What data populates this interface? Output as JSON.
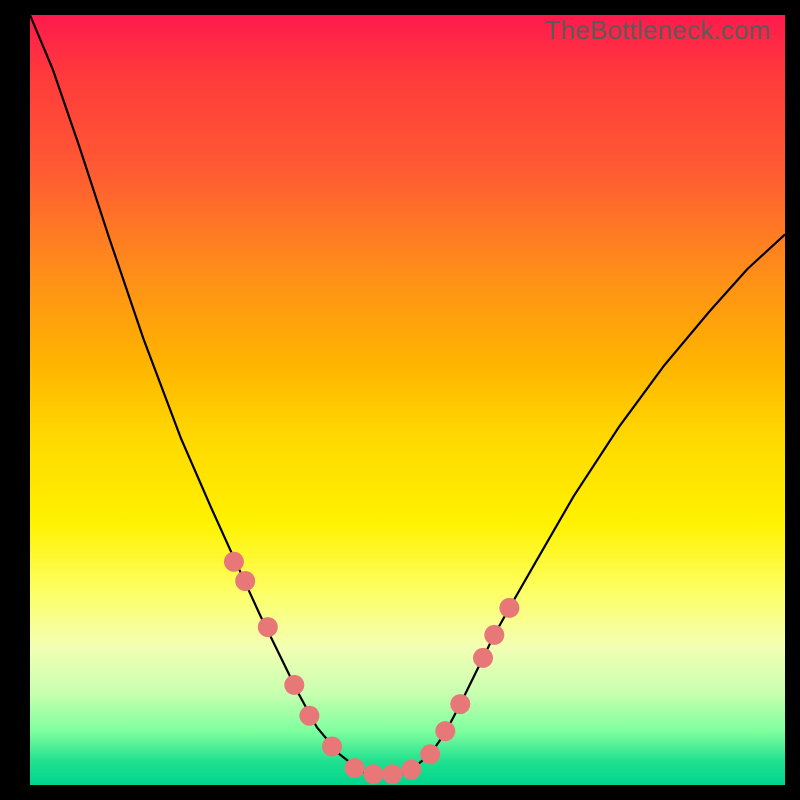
{
  "watermark": "TheBottleneck.com",
  "chart_data": {
    "type": "line",
    "title": "",
    "xlabel": "",
    "ylabel": "",
    "xlim": [
      0,
      100
    ],
    "ylim": [
      0,
      100
    ],
    "note": "Screenshot shows a bottleneck-style V-curve on a red-to-green gradient with no axis ticks or labels; values below are estimated pixel-anchored curve samples (x,y as % of plot width/height, y=0 at top).",
    "series": [
      {
        "name": "bottleneck-curve",
        "points": [
          [
            0.0,
            0.0
          ],
          [
            3.0,
            7.0
          ],
          [
            6.5,
            17.0
          ],
          [
            10.5,
            29.0
          ],
          [
            15.0,
            42.0
          ],
          [
            20.0,
            55.0
          ],
          [
            24.0,
            64.0
          ],
          [
            27.0,
            70.5
          ],
          [
            30.5,
            78.0
          ],
          [
            33.0,
            83.0
          ],
          [
            35.5,
            88.0
          ],
          [
            38.0,
            92.5
          ],
          [
            41.0,
            96.0
          ],
          [
            44.0,
            98.3
          ],
          [
            47.0,
            98.8
          ],
          [
            50.0,
            98.4
          ],
          [
            53.0,
            96.0
          ],
          [
            55.0,
            93.2
          ],
          [
            57.0,
            89.5
          ],
          [
            59.0,
            85.5
          ],
          [
            61.5,
            80.5
          ],
          [
            63.5,
            77.0
          ],
          [
            67.0,
            71.0
          ],
          [
            72.0,
            62.5
          ],
          [
            78.0,
            53.5
          ],
          [
            84.0,
            45.5
          ],
          [
            90.0,
            38.5
          ],
          [
            95.0,
            33.0
          ],
          [
            100.0,
            28.5
          ]
        ]
      }
    ],
    "markers": {
      "name": "highlighted-dots",
      "color": "#e87878",
      "points": [
        [
          27.0,
          71.0
        ],
        [
          28.5,
          73.5
        ],
        [
          31.5,
          79.5
        ],
        [
          35.0,
          87.0
        ],
        [
          37.0,
          91.0
        ],
        [
          40.0,
          95.0
        ],
        [
          43.0,
          97.8
        ],
        [
          45.5,
          98.6
        ],
        [
          48.0,
          98.6
        ],
        [
          50.5,
          98.0
        ],
        [
          53.0,
          96.0
        ],
        [
          55.0,
          93.0
        ],
        [
          57.0,
          89.5
        ],
        [
          60.0,
          83.5
        ],
        [
          61.5,
          80.5
        ],
        [
          63.5,
          77.0
        ]
      ]
    },
    "gradient_stops": [
      {
        "pos": 0.0,
        "color": "#ff1a4d"
      },
      {
        "pos": 0.33,
        "color": "#ff8c1a"
      },
      {
        "pos": 0.55,
        "color": "#ffd900"
      },
      {
        "pos": 0.82,
        "color": "#f3ffb3"
      },
      {
        "pos": 1.0,
        "color": "#00d68f"
      }
    ]
  }
}
